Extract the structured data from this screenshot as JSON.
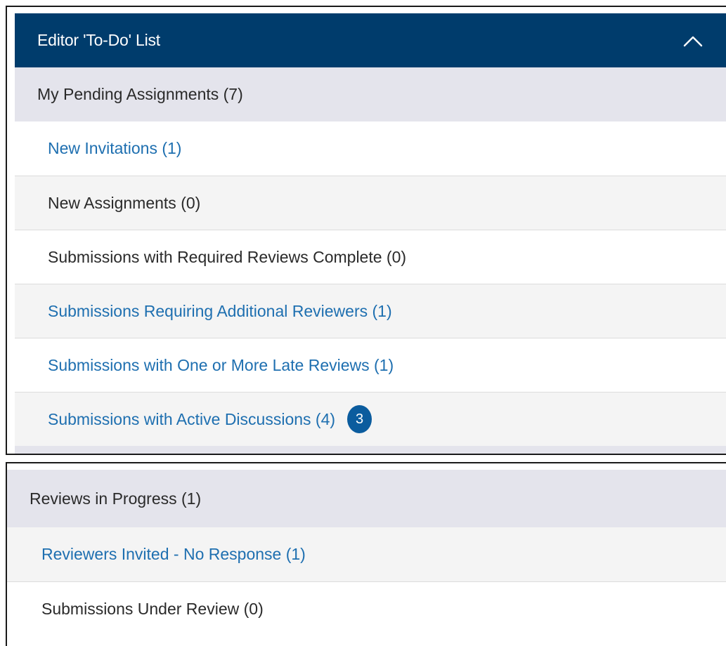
{
  "todo_panel": {
    "title": "Editor 'To-Do' List",
    "collapse_icon": "chevron-up-icon",
    "section_title": "My Pending Assignments (7)",
    "items": [
      {
        "label": "New Invitations (1)",
        "is_link": true
      },
      {
        "label": "New Assignments (0)",
        "is_link": false
      },
      {
        "label": "Submissions with Required Reviews Complete (0)",
        "is_link": false
      },
      {
        "label": "Submissions Requiring Additional Reviewers (1)",
        "is_link": true
      },
      {
        "label": "Submissions with One or More Late Reviews (1)",
        "is_link": true
      },
      {
        "label": "Submissions with Active Discussions (4)",
        "is_link": true,
        "badge": "3"
      }
    ]
  },
  "reviews_panel": {
    "section_title": "Reviews in Progress (1)",
    "items": [
      {
        "label": "Reviewers Invited - No Response (1)",
        "is_link": true
      },
      {
        "label": "Submissions Under Review (0)",
        "is_link": false
      }
    ]
  },
  "colors": {
    "header_bg": "#003c6c",
    "section_bg": "#e4e4ec",
    "link": "#1e6fb0",
    "badge_bg": "#0b5c9e"
  }
}
